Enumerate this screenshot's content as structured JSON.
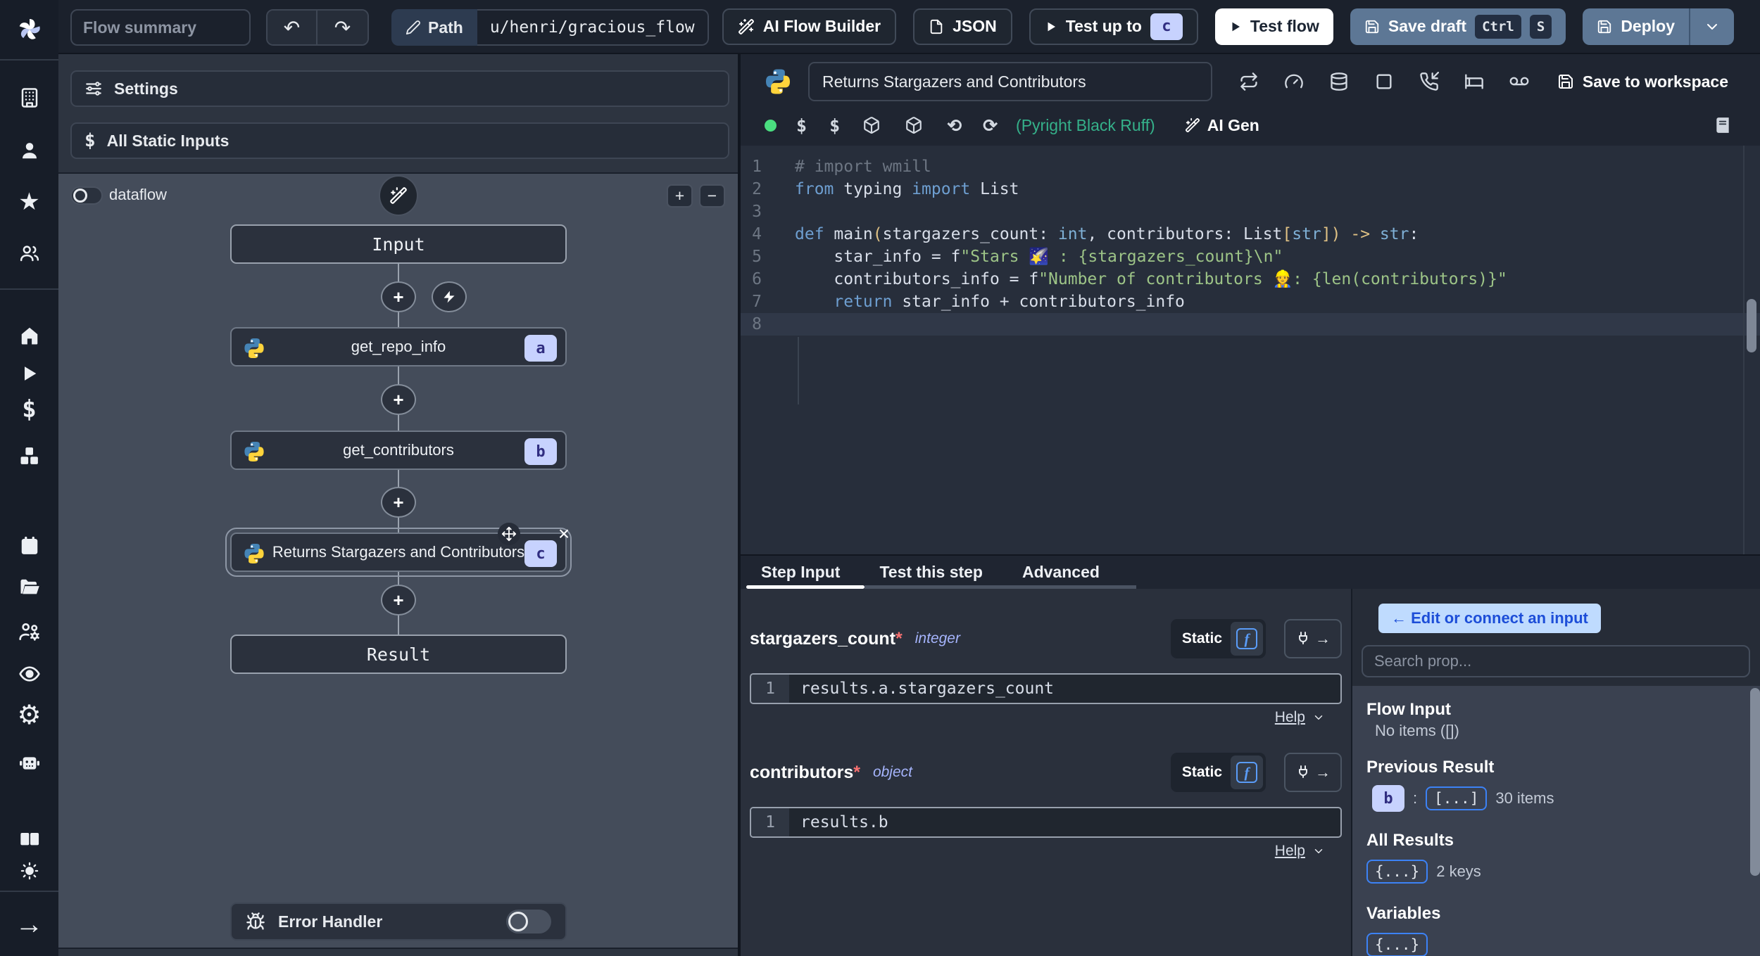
{
  "colors": {
    "accent_badge_bg": "#c7d2fe",
    "accent_badge_text": "#312e81",
    "primary_button": "#5d7795",
    "success_dot": "#4ade80",
    "assistant_green": "#35b18a",
    "connect_button_bg": "#bfdbfe",
    "connect_button_text": "#1d4ed8"
  },
  "icons": {
    "undo": "↶",
    "redo": "↷",
    "undo2": "⟲",
    "redo2": "⟳",
    "dollar": "$",
    "star": "★",
    "arrow_right": "→",
    "close": "×",
    "plus": "+",
    "minus": "−",
    "gear": "⚙"
  },
  "topbar": {
    "flow_summary_placeholder": "Flow summary",
    "path_label": "Path",
    "path_value": "u/henri/gracious_flow",
    "ai_flow_builder": "AI Flow Builder",
    "json": "JSON",
    "test_up_to": "Test up to",
    "test_up_to_badge": "c",
    "test_flow": "Test flow",
    "save_draft": "Save draft",
    "kbd_ctrl": "Ctrl",
    "kbd_s": "S",
    "deploy": "Deploy"
  },
  "left_panel": {
    "settings": "Settings",
    "all_static_inputs": "All Static Inputs",
    "dataflow": "dataflow",
    "graph": {
      "input": "Input",
      "result": "Result",
      "steps": [
        {
          "label": "get_repo_info",
          "badge": "a"
        },
        {
          "label": "get_contributors",
          "badge": "b"
        },
        {
          "label": "Returns Stargazers and Contributors",
          "badge": "c"
        }
      ],
      "error_handler": "Error Handler"
    }
  },
  "editor": {
    "title": "Returns Stargazers and Contributors",
    "save_to_workspace": "Save to workspace",
    "assistants": "(Pyright Black Ruff)",
    "ai_gen": "AI Gen",
    "active_line": 8,
    "code_lines": [
      [
        {
          "c": "cm",
          "t": "# import wmill"
        }
      ],
      [
        {
          "c": "kw",
          "t": "from"
        },
        {
          "c": "tx",
          "t": " typing "
        },
        {
          "c": "kw",
          "t": "import"
        },
        {
          "c": "tx",
          "t": " List"
        }
      ],
      [],
      [
        {
          "c": "kw",
          "t": "def"
        },
        {
          "c": "tx",
          "t": " main"
        },
        {
          "c": "br",
          "t": "("
        },
        {
          "c": "tx",
          "t": "stargazers_count: "
        },
        {
          "c": "ty",
          "t": "int"
        },
        {
          "c": "tx",
          "t": ", contributors: List"
        },
        {
          "c": "br",
          "t": "["
        },
        {
          "c": "ty",
          "t": "str"
        },
        {
          "c": "br",
          "t": "]) -> "
        },
        {
          "c": "ty",
          "t": "str"
        },
        {
          "c": "tx",
          "t": ":"
        }
      ],
      [
        {
          "c": "tx",
          "t": "    star_info = f"
        },
        {
          "c": "st",
          "t": "\"Stars 🌠 : {stargazers_count}\\n\""
        }
      ],
      [
        {
          "c": "tx",
          "t": "    contributors_info = f"
        },
        {
          "c": "st",
          "t": "\"Number of contributors 👷: {len(contributors)}\""
        }
      ],
      [
        {
          "c": "kw",
          "t": "    return"
        },
        {
          "c": "tx",
          "t": " star_info + contributors_info"
        }
      ],
      []
    ]
  },
  "tabs": {
    "step_input": "Step Input",
    "test_this_step": "Test this step",
    "advanced": "Advanced"
  },
  "step_input": {
    "fields": [
      {
        "name": "stargazers_count",
        "required": "*",
        "type": "integer",
        "mode": "Static",
        "line": "1",
        "expr": "results.a.stargazers_count",
        "help": "Help"
      },
      {
        "name": "contributors",
        "required": "*",
        "type": "object",
        "mode": "Static",
        "line": "1",
        "expr": "results.b",
        "help": "Help"
      }
    ]
  },
  "props": {
    "edit_connect": "← Edit or connect an input",
    "search_placeholder": "Search prop...",
    "flow_input_title": "Flow Input",
    "flow_input_empty": "No items ([])",
    "previous_result_title": "Previous Result",
    "previous_result_badge": "b",
    "previous_result_sep": ":",
    "previous_result_chip": "[...]",
    "previous_result_count": "30 items",
    "all_results_title": "All Results",
    "all_results_chip": "{...}",
    "all_results_count": "2 keys",
    "variables_title": "Variables",
    "variables_chip": "{...}"
  }
}
